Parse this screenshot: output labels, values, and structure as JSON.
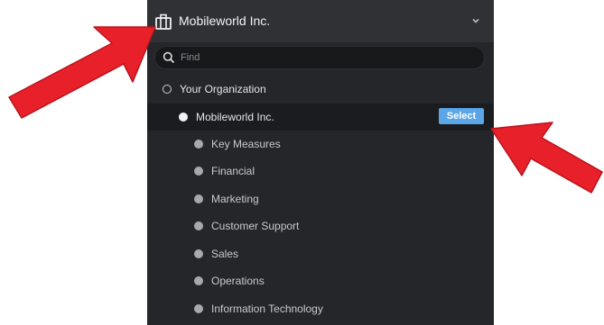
{
  "header": {
    "title": "Mobileworld Inc.",
    "icon": "briefcase-icon",
    "dropdown_icon": "chevron-down-icon"
  },
  "search": {
    "placeholder": "Find",
    "value": ""
  },
  "tree": {
    "root": {
      "label": "Your Organization"
    },
    "selected": {
      "label": "Mobileworld Inc.",
      "select_label": "Select"
    },
    "children": [
      {
        "label": "Key Measures"
      },
      {
        "label": "Financial"
      },
      {
        "label": "Marketing"
      },
      {
        "label": "Customer Support"
      },
      {
        "label": "Sales"
      },
      {
        "label": "Operations"
      },
      {
        "label": "Information Technology"
      }
    ]
  },
  "colors": {
    "panel_bg": "#252629",
    "header_bg": "#303135",
    "select_button": "#5aa6e6",
    "annotation_arrow": "#e8202a"
  }
}
